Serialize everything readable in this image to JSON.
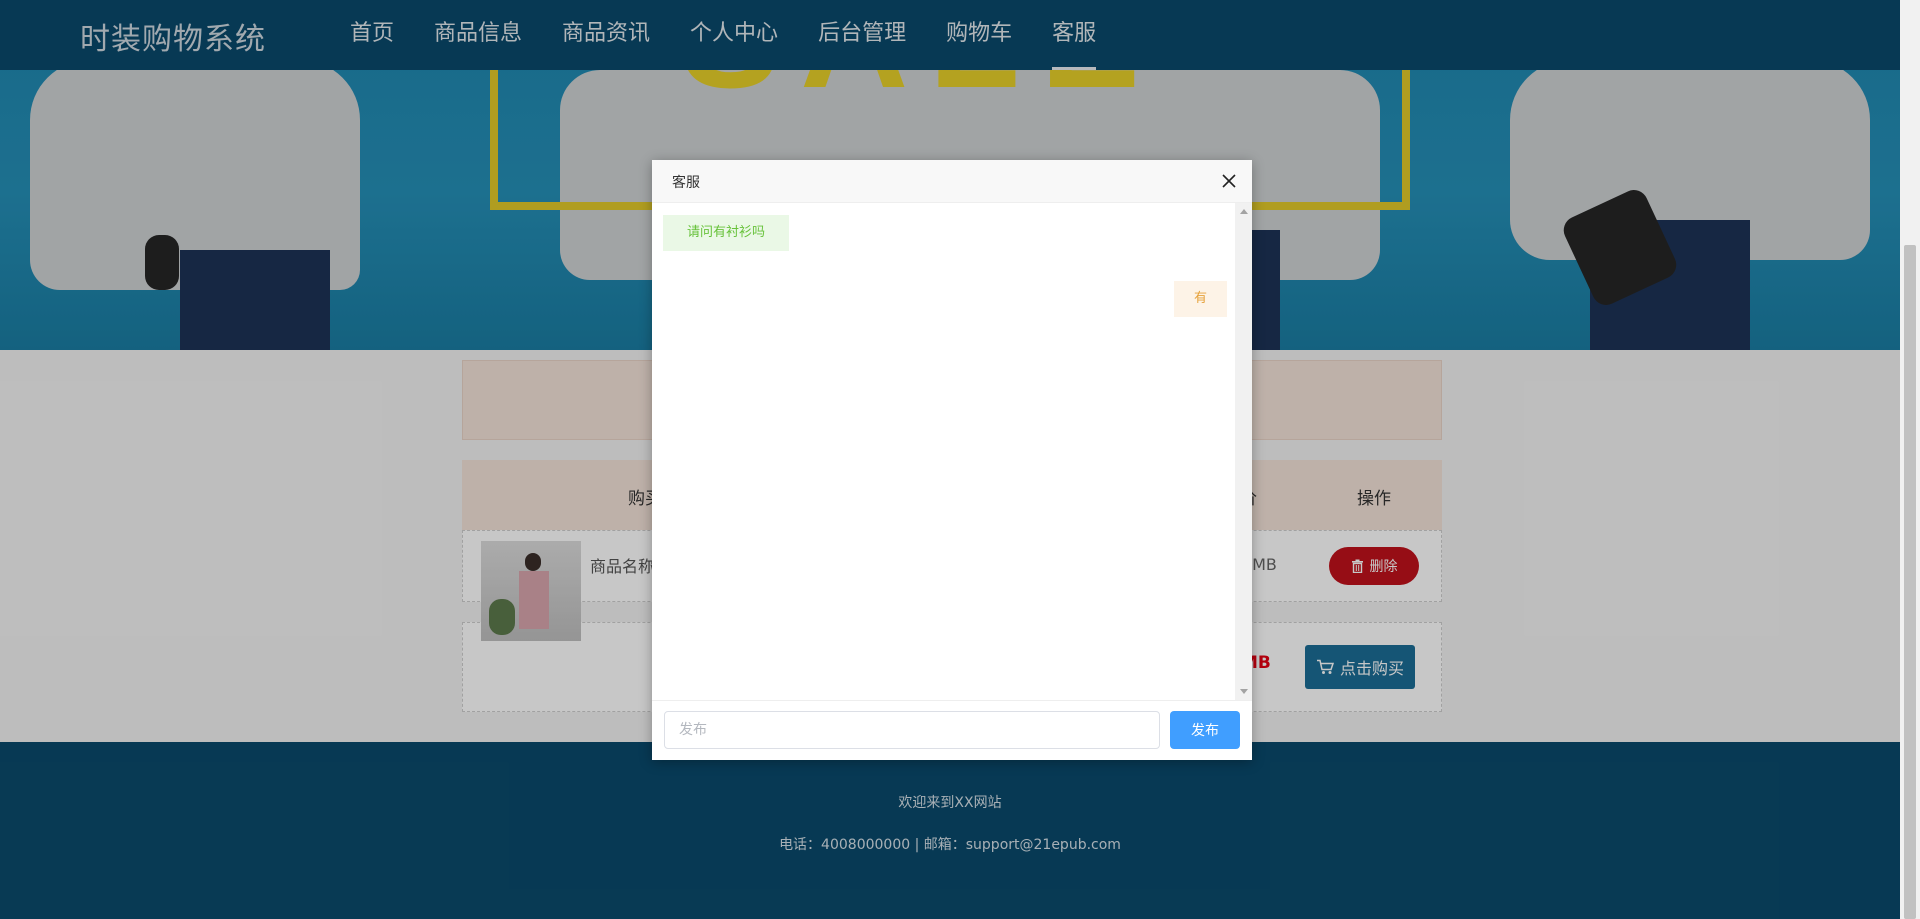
{
  "header": {
    "brand": "时装购物系统",
    "menu": [
      "首页",
      "商品信息",
      "商品资讯",
      "个人中心",
      "后台管理",
      "购物车",
      "客服"
    ],
    "active_index": 6
  },
  "cart": {
    "col_buy_partial": "购买",
    "col_price_partial": "价",
    "col_operation": "操作",
    "product_name_partial": "商品名称",
    "row_price_partial": "RMB",
    "delete_label": "删除",
    "total_partial": "MB",
    "buy_label": "点击购买"
  },
  "dialog": {
    "title": "客服",
    "messages": [
      {
        "side": "left",
        "text": "请问有衬衫吗"
      },
      {
        "side": "right",
        "text": "有"
      }
    ],
    "input_placeholder": "发布",
    "send_label": "发布"
  },
  "footer": {
    "welcome": "欢迎来到XX网站",
    "contact": "电话：4008000000 | 邮箱：support@21epub.com"
  },
  "banner": {
    "sale_text": "SALE"
  },
  "colors": {
    "nav_bg": "#0a4a6c",
    "send_button": "#409eff",
    "delete_button": "#c1111b",
    "buy_button": "#1b6e97",
    "msg_left_text": "#67c23a",
    "msg_right_text": "#e6a23c"
  }
}
